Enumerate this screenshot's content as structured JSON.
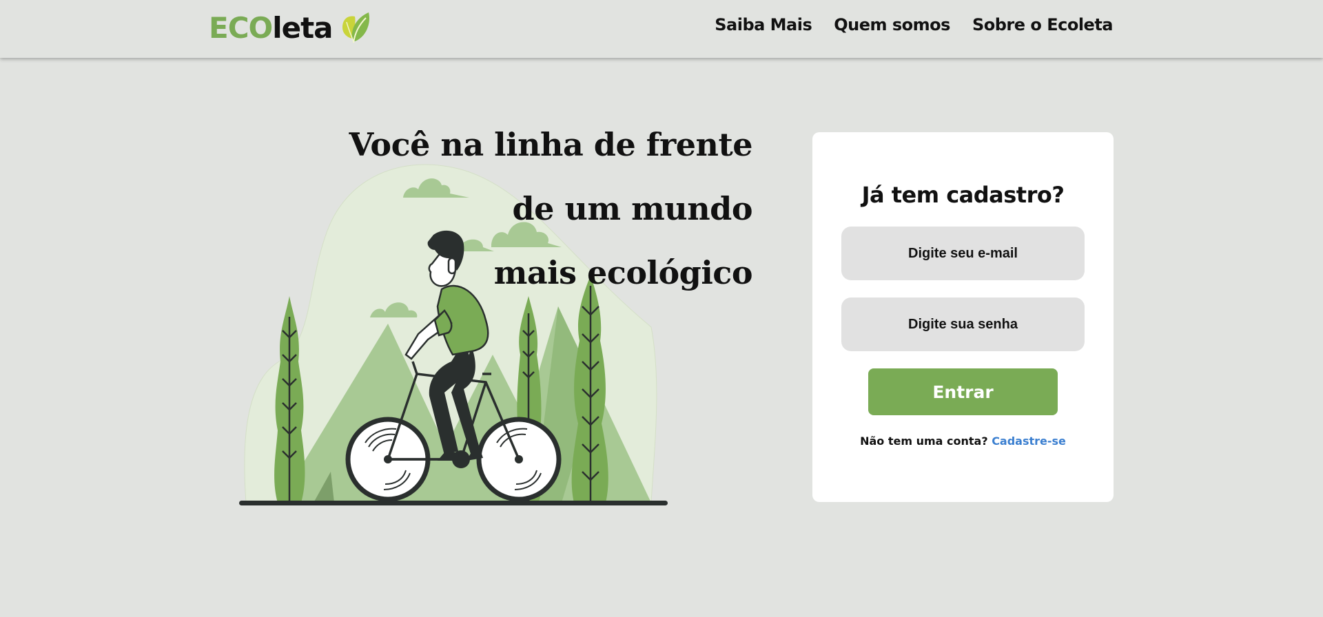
{
  "header": {
    "logo": {
      "part1": "ECO",
      "part2": "leta",
      "icon": "leaf-icon"
    },
    "nav": [
      {
        "label": "Saiba Mais"
      },
      {
        "label": "Quem somos"
      },
      {
        "label": "Sobre o Ecoleta"
      }
    ]
  },
  "hero": {
    "headline": [
      "Você na linha de frente",
      "de um mundo",
      "mais ecológico"
    ],
    "illustration": "person-riding-bicycle-in-nature"
  },
  "login": {
    "title": "Já tem cadastro?",
    "email_placeholder": "Digite seu e-mail",
    "password_placeholder": "Digite sua senha",
    "submit_label": "Entrar",
    "signup_text": "Não tem uma conta?",
    "signup_link": "Cadastre-se"
  },
  "colors": {
    "background": "#e1e3e0",
    "accent": "#7aab55",
    "link": "#3b7fd0",
    "card": "#ffffff",
    "input": "#e1e1e1"
  }
}
